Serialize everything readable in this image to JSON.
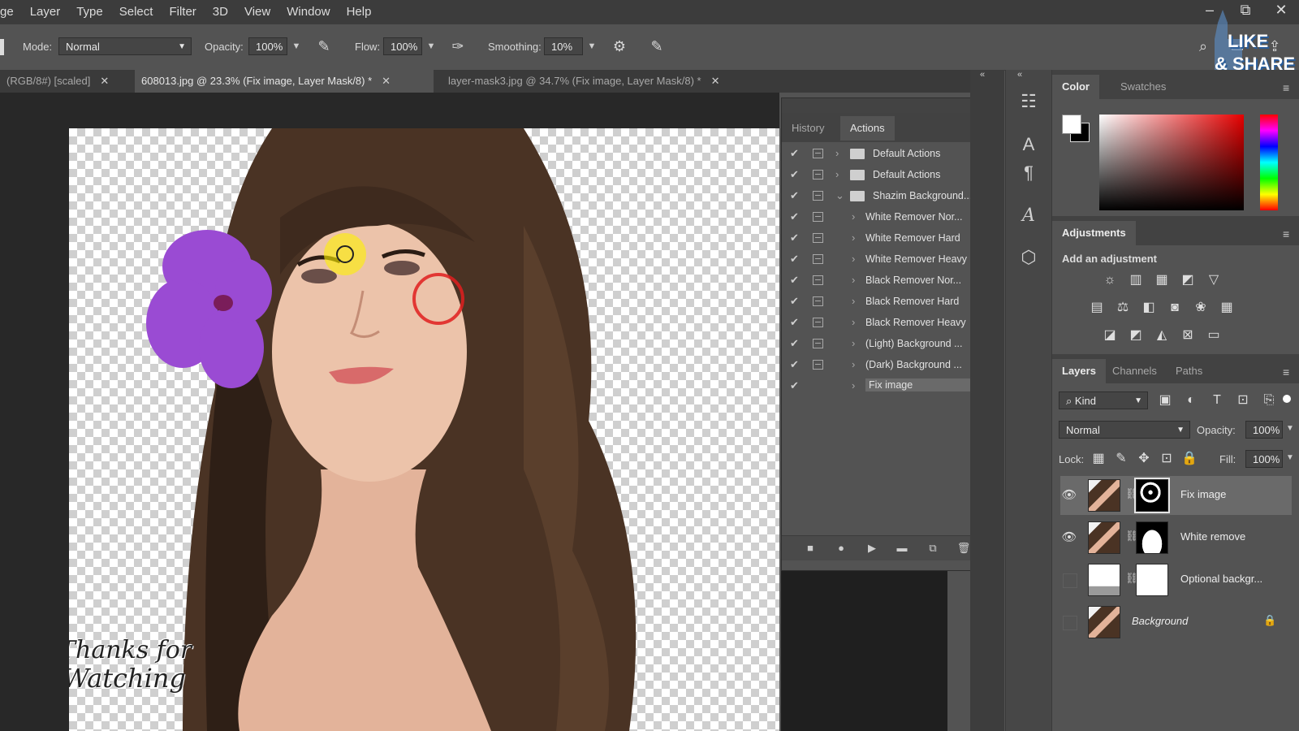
{
  "menu": {
    "items": [
      "ge",
      "Layer",
      "Type",
      "Select",
      "Filter",
      "3D",
      "View",
      "Window",
      "Help"
    ],
    "window_controls": [
      "–",
      "⧉",
      "✕"
    ]
  },
  "options": {
    "mode_label": "Mode:",
    "mode_value": "Normal",
    "opacity_label": "Opacity:",
    "opacity_value": "100%",
    "flow_label": "Flow:",
    "flow_value": "100%",
    "smoothing_label": "Smoothing:",
    "smoothing_value": "10%"
  },
  "tabs": [
    {
      "label": "(RGB/8#) [scaled]",
      "close": "✕"
    },
    {
      "label": "608013.jpg @ 23.3% (Fix image, Layer Mask/8) *",
      "close": "✕"
    },
    {
      "label": "layer-mask3.jpg @ 34.7% (Fix image, Layer Mask/8) *",
      "close": "✕"
    }
  ],
  "watermark": {
    "line1": "Thanks for",
    "line2": "Watching",
    "badge_line1": "LIKE",
    "badge_line2": "& SHARE"
  },
  "actions_panel": {
    "tabs": [
      "History",
      "Actions"
    ],
    "active_tab": "Actions",
    "rows": [
      {
        "label": "Default Actions",
        "checked": true,
        "type": "set"
      },
      {
        "label": "Default Actions",
        "checked": true,
        "type": "set"
      },
      {
        "label": "Shazim Background...",
        "checked": true,
        "type": "set-open"
      },
      {
        "label": "White Remover Nor...",
        "checked": true,
        "type": "action"
      },
      {
        "label": "White Remover Hard",
        "checked": true,
        "type": "action"
      },
      {
        "label": "White Remover Heavy",
        "checked": true,
        "type": "action"
      },
      {
        "label": "Black Remover Nor...",
        "checked": true,
        "type": "action"
      },
      {
        "label": "Black Remover Hard",
        "checked": true,
        "type": "action"
      },
      {
        "label": "Black Remover Heavy",
        "checked": true,
        "type": "action"
      },
      {
        "label": "(Light) Background ...",
        "checked": true,
        "type": "action"
      },
      {
        "label": "(Dark) Background ...",
        "checked": true,
        "type": "action"
      },
      {
        "label": "Fix image",
        "checked": true,
        "type": "action",
        "selected": true
      }
    ]
  },
  "color_panel": {
    "tabs": [
      "Color",
      "Swatches"
    ],
    "active_tab": "Color"
  },
  "adjustments_panel": {
    "title": "Adjustments",
    "subtitle": "Add an adjustment"
  },
  "layers_panel": {
    "tabs": [
      "Layers",
      "Channels",
      "Paths"
    ],
    "active_tab": "Layers",
    "filter_label": "Kind",
    "blend_mode": "Normal",
    "opacity_label": "Opacity:",
    "opacity_value": "100%",
    "lock_label": "Lock:",
    "fill_label": "Fill:",
    "fill_value": "100%",
    "layers": [
      {
        "name": "Fix image",
        "visible": true,
        "selected": true
      },
      {
        "name": "White remove",
        "visible": true,
        "selected": false
      },
      {
        "name": "Optional backgr...",
        "visible": false,
        "selected": false
      },
      {
        "name": "Background",
        "visible": false,
        "selected": false,
        "locked": true
      }
    ]
  },
  "colors": {
    "app_bg": "#535353",
    "menubar": "#3c3c3c",
    "workspace": "#282828",
    "selection": "#6a6a6a"
  }
}
